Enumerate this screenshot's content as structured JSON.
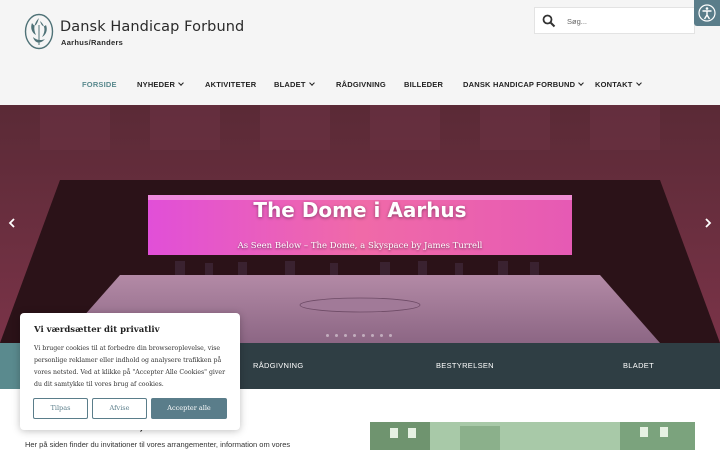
{
  "brand": {
    "title": "Dansk Handicap Forbund",
    "subtitle": "Aarhus/Randers"
  },
  "search": {
    "placeholder": "Søg..."
  },
  "accessibility": {
    "icon": "accessibility-icon"
  },
  "nav": {
    "items": [
      {
        "label": "FORSIDE",
        "active": true,
        "dropdown": false
      },
      {
        "label": "NYHEDER",
        "active": false,
        "dropdown": true
      },
      {
        "label": "AKTIVITETER",
        "active": false,
        "dropdown": false
      },
      {
        "label": "BLADET",
        "active": false,
        "dropdown": true
      },
      {
        "label": "RÅDGIVNING",
        "active": false,
        "dropdown": false
      },
      {
        "label": "BILLEDER",
        "active": false,
        "dropdown": false
      },
      {
        "label": "DANSK HANDICAP FORBUND",
        "active": false,
        "dropdown": true
      },
      {
        "label": "KONTAKT",
        "active": false,
        "dropdown": true
      }
    ]
  },
  "hero": {
    "title": "The Dome i Aarhus",
    "subtitle": "As Seen Below – The Dome, a Skyspace by James Turrell"
  },
  "quicklinks": {
    "items": [
      {
        "label": "RÅDGIVNING"
      },
      {
        "label": "BESTYRELSEN"
      },
      {
        "label": "BLADET"
      }
    ]
  },
  "content": {
    "intro_bold": "… ymeside.",
    "intro_text": "Her på siden finder du invitationer til vores arrangementer, information om vores"
  },
  "cookie": {
    "title": "Vi værdsætter dit privatliv",
    "text": "Vi bruger cookies til at forbedre din browseroplevelse, vise personlige reklamer eller indhold og analysere trafikken på vores netsted. Ved at klikke på \"Accepter Alle Cookies\" giver du dit samtykke til vores brug af cookies.",
    "customize_label": "Tilpas",
    "reject_label": "Afvise",
    "accept_label": "Accepter alle"
  },
  "colors": {
    "accent": "#5a8a8e",
    "dark_bar": "#2f3e44",
    "button": "#5a7d8a",
    "header_bg": "#f5f5f5"
  }
}
